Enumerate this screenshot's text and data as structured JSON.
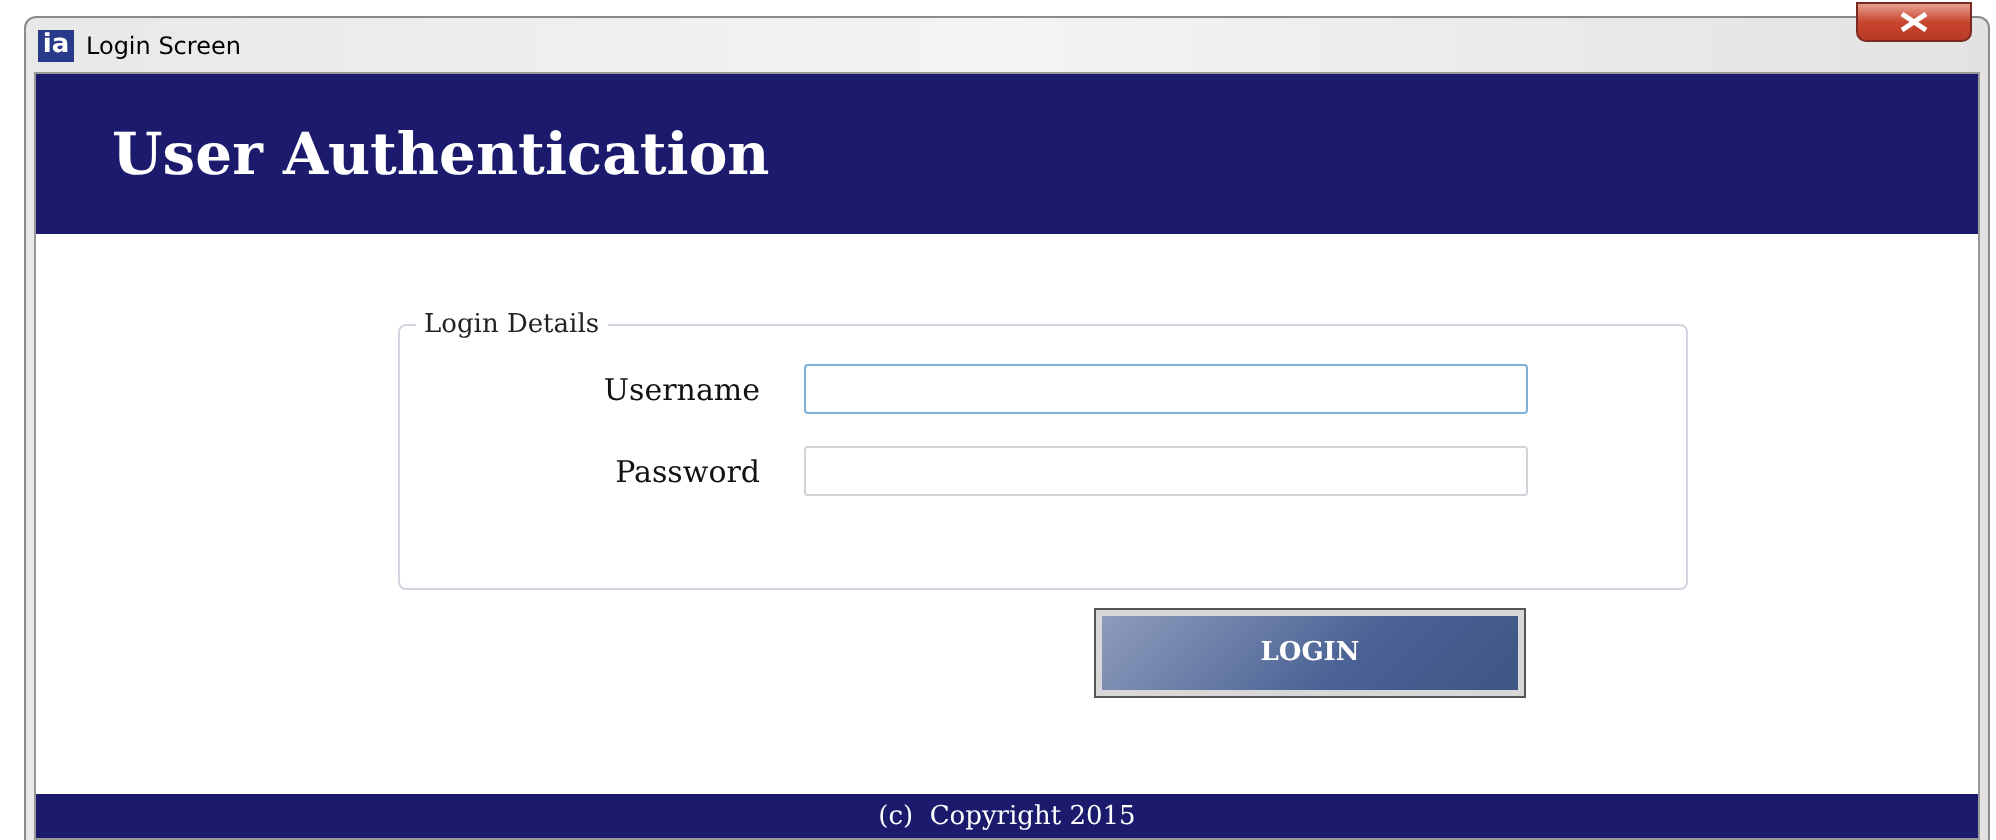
{
  "window": {
    "title": "Login Screen",
    "icon": "ia"
  },
  "header": {
    "title": "User Authentication"
  },
  "login_details": {
    "legend": "Login Details",
    "fields": [
      {
        "label": "Username",
        "focused": true
      },
      {
        "label": "Password",
        "focused": false
      }
    ]
  },
  "buttons": [
    "LOGIN"
  ],
  "footer": {
    "text": "(c)  Copyright 2015"
  }
}
